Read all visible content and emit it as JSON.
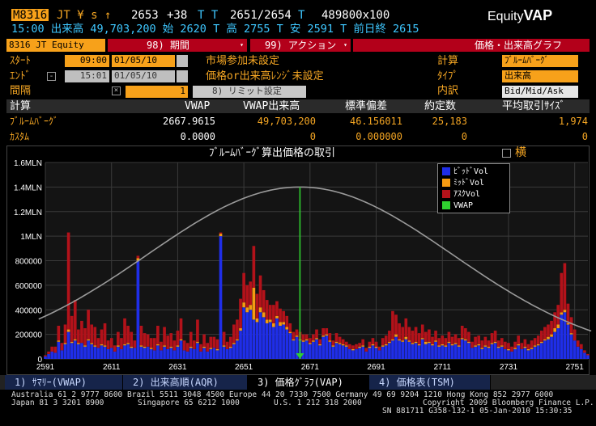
{
  "header": {
    "ticker_code": "M8316",
    "line1_rest": "JT ¥ s ↑",
    "last_price": "2653",
    "change": "+38",
    "bid_ask_prefix": "T T",
    "bid_ask": "2651/2654",
    "bid_ask_suffix": "T",
    "size": "489800x100",
    "app_title": "Equity",
    "app_title_bold": "VAP",
    "line2": "15:00 出来高 49,703,200 始 2620 T 高 2755 T 安 2591 T 前日終 2615"
  },
  "toolbar": {
    "security_field": "8316 JT Equity",
    "period_menu": "98) 期間",
    "action_menu": "99) アクション",
    "chart_type_label": "価格・出来高グラフ"
  },
  "settings": {
    "start_label": "ｽﾀｰﾄ",
    "start_time": "09:00",
    "start_date": "01/05/10",
    "end_label": "ｴﾝﾄﾞ",
    "end_time": "15:01",
    "end_date": "01/05/10",
    "interval_label": "間隔",
    "interval_value": "1",
    "limit_button": "8) リミット設定",
    "market_participant": "市場参加未設定",
    "price_range": "価格or出来高ﾚﾝｼﾞ未設定",
    "calc_label": "計算",
    "calc_value": "ﾌﾞﾙｰﾑﾊﾞｰｸﾞ",
    "type_label": "ﾀｲﾌﾟ",
    "type_value": "出来高",
    "breakdown_label": "内訳",
    "breakdown_value": "Bid/Mid/Ask"
  },
  "table": {
    "headers": [
      "計算",
      "VWAP",
      "VWAP出来高",
      "標準偏差",
      "約定数",
      "平均取引ｻｲｽﾞ"
    ],
    "rows": [
      [
        "ﾌﾞﾙｰﾑﾊﾞｰｸﾞ",
        "2667.9615",
        "49,703,200",
        "46.156011",
        "25,183",
        "1,974"
      ],
      [
        "ｶｽﾀﾑ",
        "0.0000",
        "0",
        "0.000000",
        "0",
        "0"
      ]
    ]
  },
  "chart": {
    "title": "ﾌﾞﾙｰﾑﾊﾞｰｸﾞ算出価格の取引",
    "horizontal_toggle": "横",
    "legend": [
      {
        "name": "ﾋﾞｯﾄﾞVol",
        "color": "#1f2ee8"
      },
      {
        "name": "ﾐｯﾄﾞVol",
        "color": "#f59b12"
      },
      {
        "name": "ｱｽｸVol",
        "color": "#b3121a"
      },
      {
        "name": "VWAP",
        "color": "#2fd02f"
      }
    ]
  },
  "chart_data": {
    "type": "bar",
    "title": "ﾌﾞﾙｰﾑﾊﾞｰｸﾞ算出価格の取引",
    "xlabel": "",
    "ylabel": "",
    "x_ticks": [
      2591,
      2611,
      2631,
      2651,
      2671,
      2691,
      2711,
      2731,
      2751
    ],
    "y_ticks": [
      "0",
      "200000",
      "400000",
      "600000",
      "800000",
      "1MLN",
      "1.2MLN",
      "1.4MLN",
      "1.6MLN"
    ],
    "xlim": [
      2591,
      2755
    ],
    "ylim": [
      0,
      1600000
    ],
    "vwap": 2667.9615,
    "std_dev": 46.156011,
    "normal_curve_peak": 1400000,
    "grid": true,
    "legend_position": "top-right",
    "prices": [
      2591,
      2592,
      2593,
      2594,
      2595,
      2596,
      2597,
      2598,
      2599,
      2600,
      2601,
      2602,
      2603,
      2604,
      2605,
      2606,
      2607,
      2608,
      2609,
      2610,
      2611,
      2612,
      2613,
      2614,
      2615,
      2616,
      2617,
      2618,
      2619,
      2620,
      2621,
      2622,
      2623,
      2624,
      2625,
      2626,
      2627,
      2628,
      2629,
      2630,
      2631,
      2632,
      2633,
      2634,
      2635,
      2636,
      2637,
      2638,
      2639,
      2640,
      2641,
      2642,
      2643,
      2644,
      2645,
      2646,
      2647,
      2648,
      2649,
      2650,
      2651,
      2652,
      2653,
      2654,
      2655,
      2656,
      2657,
      2658,
      2659,
      2660,
      2661,
      2662,
      2663,
      2664,
      2665,
      2666,
      2667,
      2668,
      2669,
      2670,
      2671,
      2672,
      2673,
      2674,
      2675,
      2676,
      2677,
      2678,
      2679,
      2680,
      2681,
      2682,
      2683,
      2684,
      2685,
      2686,
      2687,
      2688,
      2689,
      2690,
      2691,
      2692,
      2693,
      2694,
      2695,
      2696,
      2697,
      2698,
      2699,
      2700,
      2701,
      2702,
      2703,
      2704,
      2705,
      2706,
      2707,
      2708,
      2709,
      2710,
      2711,
      2712,
      2713,
      2714,
      2715,
      2716,
      2717,
      2718,
      2719,
      2720,
      2721,
      2722,
      2723,
      2724,
      2725,
      2726,
      2727,
      2728,
      2729,
      2730,
      2731,
      2732,
      2733,
      2734,
      2735,
      2736,
      2737,
      2738,
      2739,
      2740,
      2741,
      2742,
      2743,
      2744,
      2745,
      2746,
      2747,
      2748,
      2749,
      2750,
      2751,
      2752,
      2753,
      2754,
      2755
    ],
    "series": [
      {
        "name": "ﾋﾞｯﾄﾞVol",
        "values": [
          20000,
          40000,
          60000,
          50000,
          140000,
          70000,
          120000,
          220000,
          130000,
          150000,
          120000,
          130000,
          100000,
          150000,
          120000,
          100000,
          90000,
          110000,
          100000,
          80000,
          90000,
          60000,
          100000,
          80000,
          110000,
          120000,
          90000,
          90000,
          800000,
          100000,
          90000,
          100000,
          80000,
          70000,
          110000,
          70000,
          100000,
          80000,
          90000,
          70000,
          100000,
          150000,
          70000,
          60000,
          90000,
          80000,
          130000,
          60000,
          90000,
          60000,
          80000,
          90000,
          70000,
          1000000,
          100000,
          80000,
          90000,
          120000,
          150000,
          230000,
          420000,
          380000,
          400000,
          320000,
          300000,
          380000,
          340000,
          290000,
          300000,
          260000,
          330000,
          270000,
          280000,
          240000,
          210000,
          150000,
          180000,
          150000,
          140000,
          150000,
          120000,
          140000,
          160000,
          110000,
          180000,
          190000,
          140000,
          100000,
          130000,
          120000,
          110000,
          100000,
          80000,
          70000,
          80000,
          90000,
          100000,
          60000,
          90000,
          110000,
          90000,
          70000,
          100000,
          110000,
          130000,
          150000,
          180000,
          150000,
          140000,
          160000,
          140000,
          120000,
          130000,
          110000,
          160000,
          120000,
          130000,
          110000,
          140000,
          100000,
          110000,
          100000,
          130000,
          110000,
          120000,
          100000,
          160000,
          150000,
          130000,
          90000,
          100000,
          110000,
          80000,
          100000,
          90000,
          120000,
          130000,
          90000,
          100000,
          80000,
          70000,
          60000,
          80000,
          110000,
          80000,
          90000,
          70000,
          80000,
          100000,
          110000,
          130000,
          150000,
          160000,
          180000,
          220000,
          250000,
          360000,
          380000,
          280000,
          200000,
          150000,
          100000,
          80000,
          50000,
          30000
        ]
      },
      {
        "name": "ﾐｯﾄﾞVol",
        "values": [
          0,
          0,
          0,
          0,
          10000,
          0,
          10000,
          20000,
          10000,
          10000,
          10000,
          0,
          10000,
          10000,
          10000,
          10000,
          0,
          10000,
          10000,
          0,
          0,
          0,
          10000,
          0,
          10000,
          10000,
          10000,
          0,
          20000,
          10000,
          10000,
          0,
          10000,
          0,
          10000,
          0,
          10000,
          0,
          10000,
          0,
          10000,
          10000,
          0,
          0,
          10000,
          0,
          10000,
          0,
          10000,
          0,
          10000,
          0,
          10000,
          20000,
          10000,
          0,
          10000,
          10000,
          10000,
          20000,
          40000,
          40000,
          40000,
          260000,
          30000,
          40000,
          40000,
          30000,
          20000,
          30000,
          20000,
          30000,
          20000,
          20000,
          10000,
          10000,
          10000,
          10000,
          10000,
          10000,
          10000,
          10000,
          10000,
          10000,
          10000,
          10000,
          10000,
          10000,
          10000,
          10000,
          10000,
          10000,
          0,
          10000,
          0,
          10000,
          10000,
          0,
          10000,
          10000,
          10000,
          0,
          10000,
          10000,
          10000,
          10000,
          20000,
          10000,
          10000,
          20000,
          10000,
          10000,
          10000,
          10000,
          10000,
          20000,
          10000,
          10000,
          10000,
          10000,
          10000,
          10000,
          10000,
          10000,
          10000,
          10000,
          10000,
          10000,
          10000,
          0,
          10000,
          10000,
          10000,
          10000,
          10000,
          10000,
          10000,
          10000,
          10000,
          0,
          10000,
          0,
          10000,
          10000,
          0,
          10000,
          10000,
          10000,
          10000,
          10000,
          10000,
          10000,
          20000,
          20000,
          30000,
          30000,
          20000,
          20000,
          10000,
          10000,
          0,
          0,
          0
        ]
      },
      {
        "name": "ｱｽｸVol",
        "values": [
          10000,
          20000,
          40000,
          50000,
          120000,
          60000,
          150000,
          790000,
          210000,
          320000,
          110000,
          180000,
          140000,
          240000,
          150000,
          150000,
          80000,
          120000,
          180000,
          70000,
          80000,
          50000,
          110000,
          90000,
          210000,
          140000,
          120000,
          60000,
          20000,
          160000,
          110000,
          100000,
          80000,
          100000,
          150000,
          70000,
          150000,
          110000,
          110000,
          80000,
          120000,
          170000,
          80000,
          70000,
          120000,
          70000,
          180000,
          60000,
          100000,
          70000,
          90000,
          90000,
          80000,
          10000,
          110000,
          60000,
          80000,
          150000,
          160000,
          240000,
          240000,
          180000,
          190000,
          340000,
          200000,
          260000,
          180000,
          160000,
          120000,
          150000,
          120000,
          110000,
          90000,
          90000,
          70000,
          60000,
          50000,
          60000,
          50000,
          40000,
          40000,
          50000,
          70000,
          40000,
          60000,
          50000,
          60000,
          40000,
          70000,
          50000,
          40000,
          30000,
          40000,
          30000,
          40000,
          30000,
          50000,
          30000,
          40000,
          50000,
          40000,
          30000,
          60000,
          70000,
          90000,
          230000,
          160000,
          130000,
          110000,
          150000,
          110000,
          100000,
          120000,
          90000,
          110000,
          80000,
          100000,
          60000,
          80000,
          60000,
          70000,
          60000,
          80000,
          60000,
          70000,
          60000,
          100000,
          90000,
          80000,
          50000,
          70000,
          70000,
          60000,
          70000,
          50000,
          80000,
          90000,
          50000,
          60000,
          60000,
          50000,
          40000,
          50000,
          70000,
          50000,
          60000,
          40000,
          60000,
          60000,
          70000,
          90000,
          100000,
          100000,
          110000,
          130000,
          160000,
          320000,
          380000,
          160000,
          130000,
          90000,
          50000,
          40000,
          20000,
          10000
        ]
      }
    ]
  },
  "tabs": [
    {
      "label": "1) ｻﾏﾘｰ(VWAP)"
    },
    {
      "label": "2) 出来高順(AQR)"
    },
    {
      "label": "3) 価格ｸﾞﾗﾌ(VAP)"
    },
    {
      "label": "4) 価格表(TSM)"
    }
  ],
  "footer": {
    "line1": "Australia 61 2 9777 8600 Brazil 5511 3048 4500 Europe 44 20 7330 7500 Germany 49 69 9204 1210 Hong Kong 852 2977 6000",
    "line2_left": "Japan 81 3 3201 8900",
    "line2_mid1": "Singapore 65 6212 1000",
    "line2_mid2": "U.S. 1 212 318 2000",
    "line2_right": "Copyright 2009 Bloomberg Finance L.P.",
    "line3": "SN 881711 G358-132-1 05-Jan-2010 15:30:35"
  }
}
